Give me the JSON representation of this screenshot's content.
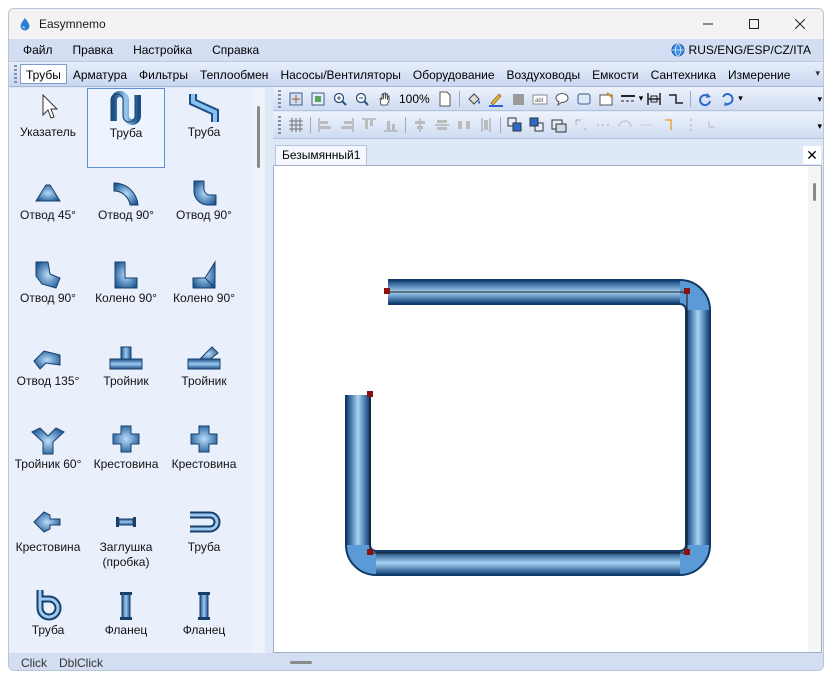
{
  "window": {
    "title": "Easymnemo"
  },
  "menu": {
    "items": [
      "Файл",
      "Правка",
      "Настройка",
      "Справка"
    ],
    "language": "RUS/ENG/ESP/CZ/ITA"
  },
  "categories": {
    "items": [
      "Трубы",
      "Арматура",
      "Фильтры",
      "Теплообмен",
      "Насосы/Вентиляторы",
      "Оборудование",
      "Воздуховоды",
      "Емкости",
      "Сантехника",
      "Измерение"
    ],
    "active": "Трубы"
  },
  "palette": {
    "items": [
      {
        "label": "Указатель",
        "icon": "pointer-icon"
      },
      {
        "label": "Труба",
        "icon": "pipe-u-icon"
      },
      {
        "label": "Труба",
        "icon": "pipe-s-icon"
      },
      {
        "label": "Отвод 45°",
        "icon": "elbow-45-icon"
      },
      {
        "label": "Отвод 90°",
        "icon": "elbow-90-icon"
      },
      {
        "label": "Отвод 90°",
        "icon": "elbow-90b-icon"
      },
      {
        "label": "Отвод 90°",
        "icon": "elbow-90c-icon"
      },
      {
        "label": "Колено 90°",
        "icon": "knee-90-icon"
      },
      {
        "label": "Колено 90°",
        "icon": "knee-90b-icon"
      },
      {
        "label": "Отвод 135°",
        "icon": "elbow-135-icon"
      },
      {
        "label": "Тройник",
        "icon": "tee-icon"
      },
      {
        "label": "Тройник",
        "icon": "tee-angle-icon"
      },
      {
        "label": "Тройник 60°",
        "icon": "tee-60-icon"
      },
      {
        "label": "Крестовина",
        "icon": "cross-icon"
      },
      {
        "label": "Крестовина",
        "icon": "cross-b-icon"
      },
      {
        "label": "Крестовина",
        "icon": "cross-arrow-icon"
      },
      {
        "label": "Заглушка (пробка)",
        "icon": "plug-icon"
      },
      {
        "label": "Труба",
        "icon": "pipe-return-icon"
      },
      {
        "label": "Труба",
        "icon": "pipe-loop-icon"
      },
      {
        "label": "Фланец",
        "icon": "flange-icon"
      },
      {
        "label": "Фланец",
        "icon": "flange-b-icon"
      }
    ],
    "selected": "Труба"
  },
  "toolbar": {
    "zoom": "100%"
  },
  "document": {
    "tab": "Безымянный1"
  },
  "status": {
    "click": "Click",
    "dblclick": "DblClick"
  },
  "colors": {
    "pipe": "#6aa6dd",
    "pipe_dark": "#1b4f86",
    "handle": "#8b1010",
    "accent": "#dfe8f7"
  }
}
